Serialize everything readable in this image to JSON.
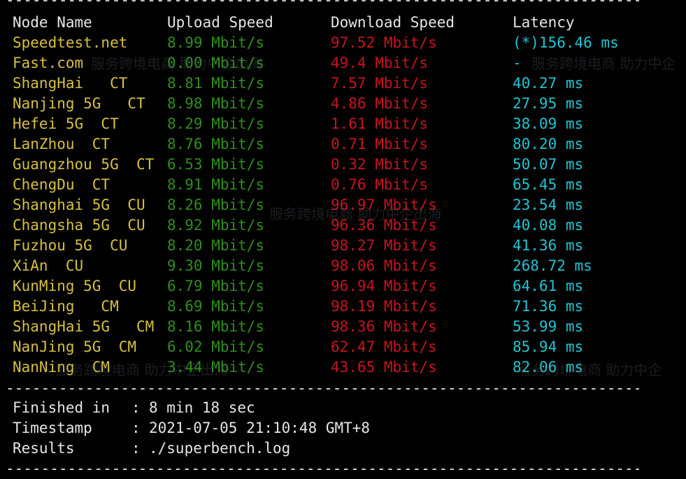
{
  "colors": {
    "background": "#000000",
    "header": "#e6e6e6",
    "node": "#d6c040",
    "upload": "#2f8f1c",
    "download": "#c8141e",
    "latency": "#21c5d2",
    "summary": "#e6e6e6"
  },
  "divider_text": "------------------------------------------------------------------------------",
  "headers": {
    "node": "Node Name",
    "upload": "Upload Speed",
    "download": "Download Speed",
    "latency": "Latency"
  },
  "rows": [
    {
      "node": "Speedtest.net",
      "upload": "8.99 Mbit/s",
      "download": "97.52 Mbit/s",
      "latency": "(*)156.46 ms"
    },
    {
      "node": "Fast.com",
      "upload": "0.00 Mbit/s",
      "download": "49.4 Mbit/s",
      "latency": "-"
    },
    {
      "node": "ShangHai   CT",
      "upload": "8.81 Mbit/s",
      "download": "7.57 Mbit/s",
      "latency": "40.27 ms"
    },
    {
      "node": "Nanjing 5G   CT",
      "upload": "8.98 Mbit/s",
      "download": "4.86 Mbit/s",
      "latency": "27.95 ms"
    },
    {
      "node": "Hefei 5G  CT",
      "upload": "8.29 Mbit/s",
      "download": "1.61 Mbit/s",
      "latency": "38.09 ms"
    },
    {
      "node": "LanZhou  CT",
      "upload": "8.76 Mbit/s",
      "download": "0.71 Mbit/s",
      "latency": "80.20 ms"
    },
    {
      "node": "Guangzhou 5G  CT",
      "upload": "6.53 Mbit/s",
      "download": "0.32 Mbit/s",
      "latency": "50.07 ms"
    },
    {
      "node": "ChengDu  CT",
      "upload": "8.91 Mbit/s",
      "download": "0.76 Mbit/s",
      "latency": "65.45 ms"
    },
    {
      "node": "Shanghai 5G  CU",
      "upload": "8.26 Mbit/s",
      "download": "96.97 Mbit/s",
      "latency": "23.54 ms"
    },
    {
      "node": "Changsha 5G  CU",
      "upload": "8.92 Mbit/s",
      "download": "96.36 Mbit/s",
      "latency": "40.08 ms"
    },
    {
      "node": "Fuzhou 5G  CU",
      "upload": "8.20 Mbit/s",
      "download": "98.27 Mbit/s",
      "latency": "41.36 ms"
    },
    {
      "node": "XiAn  CU",
      "upload": "9.30 Mbit/s",
      "download": "98.06 Mbit/s",
      "latency": "268.72 ms"
    },
    {
      "node": "KunMing 5G  CU",
      "upload": "6.79 Mbit/s",
      "download": "96.94 Mbit/s",
      "latency": "64.61 ms"
    },
    {
      "node": "BeiJing   CM",
      "upload": "8.69 Mbit/s",
      "download": "98.19 Mbit/s",
      "latency": "71.36 ms"
    },
    {
      "node": "ShangHai 5G   CM",
      "upload": "8.16 Mbit/s",
      "download": "98.36 Mbit/s",
      "latency": "53.99 ms"
    },
    {
      "node": "NanJing 5G  CM",
      "upload": "6.02 Mbit/s",
      "download": "62.47 Mbit/s",
      "latency": "85.94 ms"
    },
    {
      "node": "NanNing  CM",
      "upload": "3.44 Mbit/s",
      "download": "43.65 Mbit/s",
      "latency": "82.06 ms"
    }
  ],
  "summary": [
    {
      "label": "Finished in",
      "colon": ":",
      "value": "8 min 18 sec"
    },
    {
      "label": "Timestamp",
      "colon": ":",
      "value": "2021-07-05 21:10:48 GMT+8"
    },
    {
      "label": "Results",
      "colon": ":",
      "value": "./superbench.log"
    }
  ],
  "watermark": {
    "tagline_1": "服务跨境电商 助力中企出海",
    "tagline_2": "服务跨境电商 助力中企"
  }
}
